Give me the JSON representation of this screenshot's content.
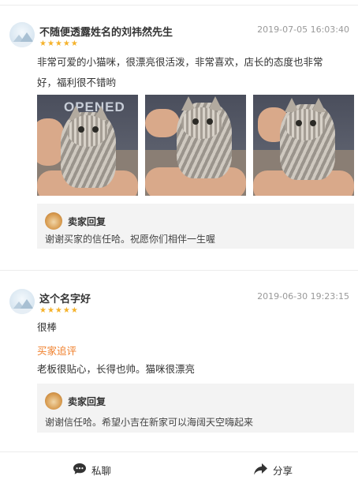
{
  "reviews": [
    {
      "name": "不随便透露姓名的刘祎然先生",
      "date": "2019-07-05 16:03:40",
      "stars": "★★★★★",
      "text_line1": "非常可爱的小猫咪，很漂亮很活泼，非常喜欢，店长的态度也非常",
      "text_line2": "好，福利很不错哟",
      "photo_shirt_text": "OPENED",
      "reply": {
        "title": "卖家回复",
        "text": "谢谢买家的信任哈。祝愿你们相伴一生喔"
      }
    },
    {
      "name": "这个名字好",
      "date": "2019-06-30 19:23:15",
      "stars": "★★★★★",
      "text": "很棒",
      "followup_label": "买家追评",
      "followup_text": "老板很贴心，长得也帅。猫咪很漂亮",
      "reply": {
        "title": "卖家回复",
        "text": "谢谢信任哈。希望小吉在新家可以海阔天空嗨起来"
      }
    }
  ],
  "footer": {
    "chat_label": "私聊",
    "share_label": "分享"
  },
  "colors": {
    "star": "#f5b22b",
    "followup": "#f0802c",
    "reply_bg": "#f3f3f3"
  },
  "icons": {
    "chat": "chat-bubble-icon",
    "share": "share-arrow-icon"
  }
}
